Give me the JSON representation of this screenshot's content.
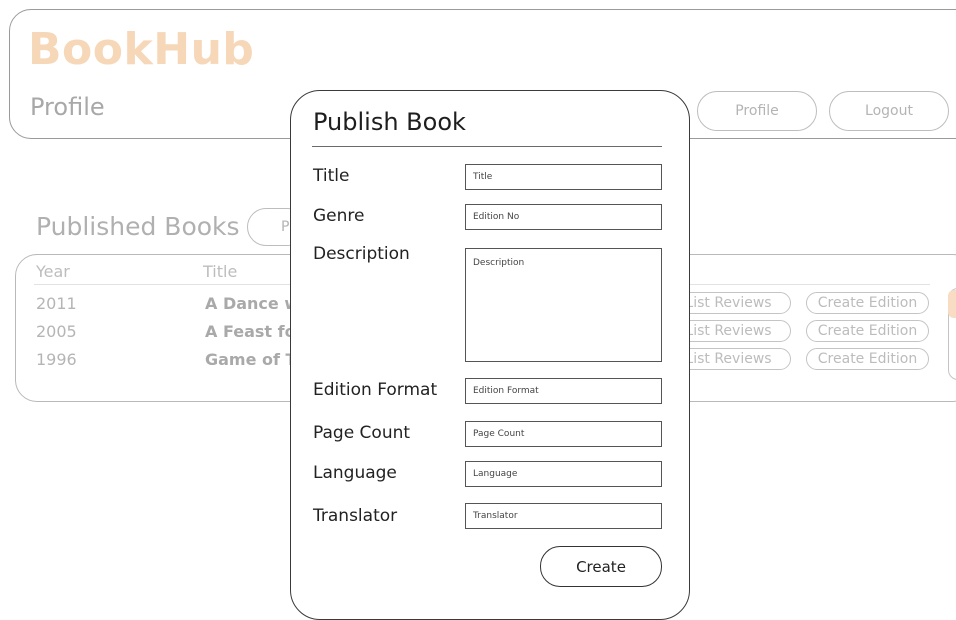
{
  "header": {
    "logo_text": "BookHub",
    "page_subtitle": "Profile",
    "nav": {
      "profile_label": "Profile",
      "logout_label": "Logout"
    }
  },
  "published": {
    "section_title": "Published Books",
    "partial_button_label": "P",
    "columns": {
      "year": "Year",
      "title": "Title"
    },
    "rows": [
      {
        "year": "2011",
        "title": "A Dance w",
        "list_reviews": "List Reviews",
        "create_edition": "Create Edition"
      },
      {
        "year": "2005",
        "title": "A Feast fo",
        "list_reviews": "List Reviews",
        "create_edition": "Create Edition"
      },
      {
        "year": "1996",
        "title": "Game of T",
        "list_reviews": "List Reviews",
        "create_edition": "Create Edition"
      }
    ]
  },
  "modal": {
    "title": "Publish Book",
    "fields": [
      {
        "label": "Title",
        "placeholder": "Title"
      },
      {
        "label": "Genre",
        "placeholder": "Edition No"
      },
      {
        "label": "Description",
        "placeholder": "Description"
      },
      {
        "label": "Edition Format",
        "placeholder": "Edition Format"
      },
      {
        "label": "Page Count",
        "placeholder": "Page Count"
      },
      {
        "label": "Language",
        "placeholder": "Language"
      },
      {
        "label": "Translator",
        "placeholder": "Translator"
      }
    ],
    "create_label": "Create"
  },
  "colors": {
    "brand": "#f6d7b8",
    "muted_text": "#b0b0b0",
    "border_dark": "#333333"
  }
}
